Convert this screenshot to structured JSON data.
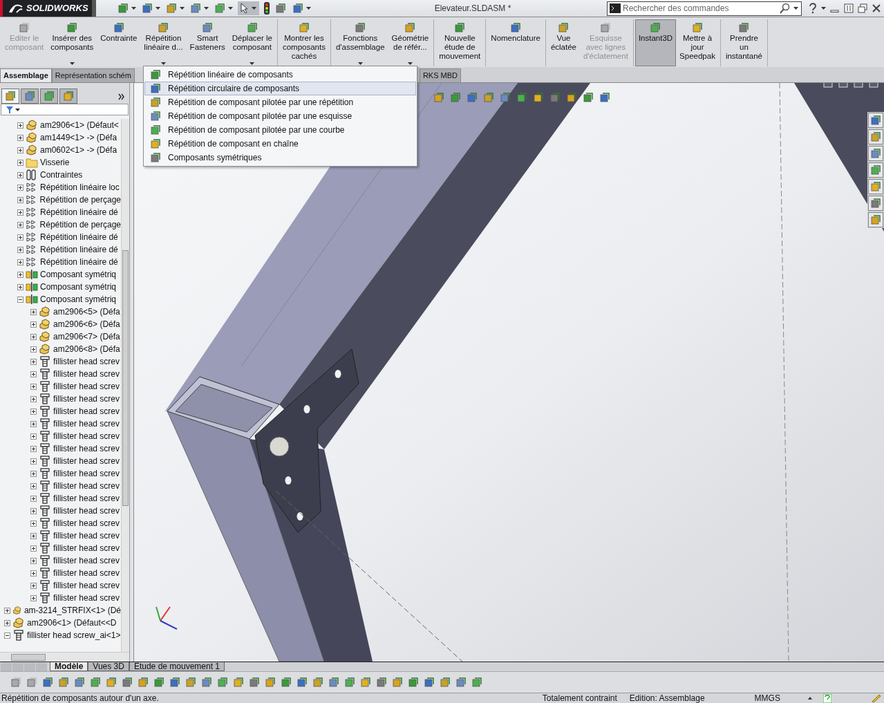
{
  "title_bar": {
    "logo": "SOLIDWORKS",
    "title": "Elevateur.SLDASM *",
    "search": {
      "placeholder": "Rechercher des commandes"
    }
  },
  "ribbon": {
    "groups": [
      [
        {
          "label": "Editer le\ncomposant",
          "disabled": true,
          "pressed": false,
          "dropdown": false
        },
        {
          "label": "Insérer des\ncomposants",
          "disabled": false,
          "pressed": false,
          "dropdown": true
        },
        {
          "label": "Contrainte",
          "disabled": false,
          "pressed": false,
          "dropdown": false
        },
        {
          "label": "Répétition\nlinéaire d...",
          "disabled": false,
          "pressed": false,
          "dropdown": true
        },
        {
          "label": "Smart\nFasteners",
          "disabled": false,
          "pressed": false,
          "dropdown": false
        },
        {
          "label": "Déplacer le\ncomposant",
          "disabled": false,
          "pressed": false,
          "dropdown": true
        }
      ],
      [
        {
          "label": "Montrer les\ncomposants\ncachés",
          "disabled": false,
          "pressed": false,
          "dropdown": false
        }
      ],
      [
        {
          "label": "Fonctions\nd'assemblage",
          "disabled": false,
          "pressed": false,
          "dropdown": true
        },
        {
          "label": "Géométrie\nde référ...",
          "disabled": false,
          "pressed": false,
          "dropdown": true
        }
      ],
      [
        {
          "label": "Nouvelle\nétude de\nmouvement",
          "disabled": false,
          "pressed": false,
          "dropdown": false
        }
      ],
      [
        {
          "label": "Nomenclature",
          "disabled": false,
          "pressed": false,
          "dropdown": false
        }
      ],
      [
        {
          "label": "Vue\néclatée",
          "disabled": false,
          "pressed": false,
          "dropdown": false
        },
        {
          "label": "Esquisse\navec lignes\nd'éclatement",
          "disabled": true,
          "pressed": false,
          "dropdown": false
        }
      ],
      [
        {
          "label": "Instant3D",
          "disabled": false,
          "pressed": true,
          "dropdown": false
        },
        {
          "label": "Mettre à\njour\nSpeedpak",
          "disabled": false,
          "pressed": false,
          "dropdown": false
        }
      ],
      [
        {
          "label": "Prendre\nun\ninstantané",
          "disabled": false,
          "pressed": false,
          "dropdown": false
        }
      ]
    ]
  },
  "command_tabs": [
    {
      "label": "Assemblage",
      "selected": true
    },
    {
      "label": "Représentation schém",
      "selected": false
    },
    {
      "label": "RKS MBD",
      "selected": false
    }
  ],
  "dropdown_menu": [
    {
      "label": "Répétition linéaire de composants",
      "selected": false
    },
    {
      "label": "Répétition circulaire de composants",
      "selected": true
    },
    {
      "label": "Répétition de composant pilotée par une répétition",
      "selected": false
    },
    {
      "label": "Répétition de composant pilotée par une esquisse",
      "selected": false
    },
    {
      "label": "Répétition de composant pilotée par une courbe",
      "selected": false
    },
    {
      "label": "Répétition de composant en chaîne",
      "selected": false
    },
    {
      "label": "Composants symétriques",
      "selected": false
    }
  ],
  "panel_tabs": [
    {
      "selected": true
    },
    {
      "selected": false
    },
    {
      "selected": false
    },
    {
      "selected": false
    }
  ],
  "tree": {
    "continued_items": [
      {
        "label": "am2906<1> (Défaut<",
        "kind": "part",
        "expanded": false
      },
      {
        "label": "am1449<1> -> (Défa",
        "kind": "part",
        "expanded": false
      },
      {
        "label": "am0602<1> -> (Défa",
        "kind": "part",
        "expanded": false
      },
      {
        "label": "Visserie",
        "kind": "folder",
        "expanded": false
      },
      {
        "label": "Contraintes",
        "kind": "mates",
        "expanded": false
      },
      {
        "label": "Répétition linéaire loc",
        "kind": "pattern",
        "expanded": false
      },
      {
        "label": "Répétition de perçage",
        "kind": "pattern",
        "expanded": false
      },
      {
        "label": "Répétition linéaire dé",
        "kind": "pattern",
        "expanded": false
      },
      {
        "label": "Répétition de perçage",
        "kind": "pattern",
        "expanded": false
      },
      {
        "label": "Répétition linéaire dé",
        "kind": "pattern",
        "expanded": false
      },
      {
        "label": "Répétition linéaire dé",
        "kind": "pattern",
        "expanded": false
      },
      {
        "label": "Répétition linéaire dé",
        "kind": "pattern",
        "expanded": false
      },
      {
        "label": "Composant symétriq",
        "kind": "mirror",
        "expanded": false
      },
      {
        "label": "Composant symétriq",
        "kind": "mirror",
        "expanded": false
      },
      {
        "label": "Composant symétriq",
        "kind": "mirror",
        "expanded": true,
        "children": [
          {
            "label": "am2906<5> (Défa",
            "kind": "part",
            "expanded": false
          },
          {
            "label": "am2906<6> (Défa",
            "kind": "part",
            "expanded": false
          },
          {
            "label": "am2906<7> (Défa",
            "kind": "part",
            "expanded": false
          },
          {
            "label": "am2906<8> (Défa",
            "kind": "part",
            "expanded": false
          },
          {
            "label": "fillister head screv",
            "kind": "screw",
            "expanded": false
          },
          {
            "label": "fillister head screv",
            "kind": "screw",
            "expanded": false
          },
          {
            "label": "fillister head screv",
            "kind": "screw",
            "expanded": false
          },
          {
            "label": "fillister head screv",
            "kind": "screw",
            "expanded": false
          },
          {
            "label": "fillister head screv",
            "kind": "screw",
            "expanded": false
          },
          {
            "label": "fillister head screv",
            "kind": "screw",
            "expanded": false
          },
          {
            "label": "fillister head screv",
            "kind": "screw",
            "expanded": false
          },
          {
            "label": "fillister head screv",
            "kind": "screw",
            "expanded": false
          },
          {
            "label": "fillister head screv",
            "kind": "screw",
            "expanded": false
          },
          {
            "label": "fillister head screv",
            "kind": "screw",
            "expanded": false
          },
          {
            "label": "fillister head screv",
            "kind": "screw",
            "expanded": false
          },
          {
            "label": "fillister head screv",
            "kind": "screw",
            "expanded": false
          },
          {
            "label": "fillister head screv",
            "kind": "screw",
            "expanded": false
          },
          {
            "label": "fillister head screv",
            "kind": "screw",
            "expanded": false
          },
          {
            "label": "fillister head screv",
            "kind": "screw",
            "expanded": false
          },
          {
            "label": "fillister head screv",
            "kind": "screw",
            "expanded": false
          },
          {
            "label": "fillister head screv",
            "kind": "screw",
            "expanded": false
          },
          {
            "label": "fillister head screv",
            "kind": "screw",
            "expanded": false
          },
          {
            "label": "fillister head screv",
            "kind": "screw",
            "expanded": false
          },
          {
            "label": "fillister head screv",
            "kind": "screw",
            "expanded": false
          }
        ]
      }
    ],
    "items": [
      {
        "label": "am-3214_STRFIX<1> (Dé",
        "kind": "part",
        "expanded": false
      },
      {
        "label": "am2906<1> (Défaut<<D",
        "kind": "part",
        "expanded": false
      },
      {
        "label": "fillister head screw_ai<1>",
        "kind": "screw",
        "expanded": true
      }
    ]
  },
  "bottom_tabs": [
    {
      "label": "Modèle",
      "selected": true
    },
    {
      "label": "Vues 3D",
      "selected": false
    },
    {
      "label": "Etude de mouvement 1",
      "selected": false
    }
  ],
  "status_bar": {
    "message": "Répétition de composants autour d'un axe.",
    "constraint": "Totalement contraint",
    "mode": "Edition: Assemblage",
    "units": "MMGS"
  }
}
